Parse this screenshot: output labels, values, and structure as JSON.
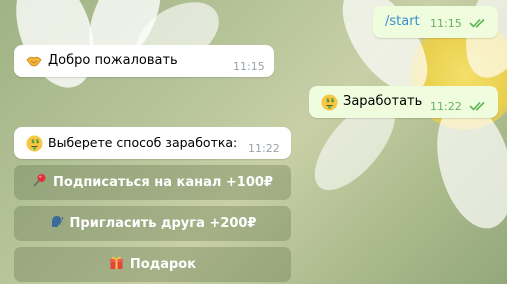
{
  "chat": {
    "messages": [
      {
        "side": "out",
        "text": "/start",
        "time": "11:15",
        "status": "read"
      },
      {
        "side": "in",
        "emoji": "handshake-icon",
        "text": "Добро пожаловать",
        "time": "11:15"
      },
      {
        "side": "out",
        "emoji": "money-face-icon",
        "text": "Заработать",
        "time": "11:22",
        "status": "read"
      },
      {
        "side": "in",
        "emoji": "money-face-icon",
        "text": "Выберете способ заработка:",
        "time": "11:22"
      }
    ]
  },
  "keyboard": {
    "buttons": [
      {
        "icon": "pushpin-icon",
        "label": "Подписаться на канал +100₽"
      },
      {
        "icon": "speaking-head-icon",
        "label": "Пригласить друга +200₽"
      },
      {
        "icon": "gift-icon",
        "label": "Подарок"
      }
    ]
  },
  "colors": {
    "outgoing_bubble": "#effdde",
    "incoming_bubble": "#ffffff",
    "read_checks": "#5fb453",
    "keyboard_button": "rgba(92,112,72,0.32)"
  }
}
